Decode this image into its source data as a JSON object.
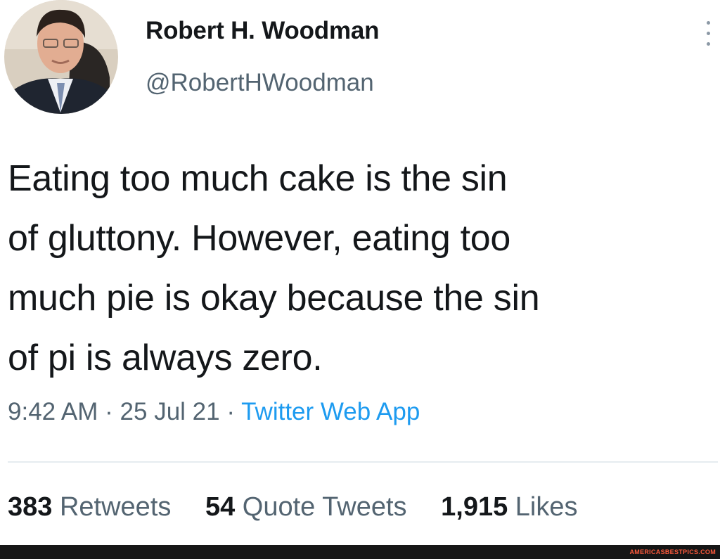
{
  "author": {
    "display_name": "Robert H. Woodman",
    "handle": "@RobertHWoodman",
    "avatar_icon": "profile-photo"
  },
  "more_icon": "vertical-ellipsis-icon",
  "tweet": {
    "text_lines": [
      "Eating too much cake is the sin",
      "of gluttony. However, eating too",
      "much pie is okay because the sin",
      "of pi is always zero."
    ],
    "time": "9:42 AM",
    "separator": "·",
    "date": "25 Jul 21",
    "source": "Twitter Web App"
  },
  "stats": {
    "retweets_count": "383",
    "retweets_label": "Retweets",
    "quote_count": "54",
    "quote_label": "Quote Tweets",
    "likes_count": "1,915",
    "likes_label": "Likes"
  },
  "watermark": "AMERICASBESTPICS.COM",
  "colors": {
    "text": "#14171a",
    "secondary": "#536471",
    "accent": "#1d9bf0",
    "footer": "#161616"
  }
}
